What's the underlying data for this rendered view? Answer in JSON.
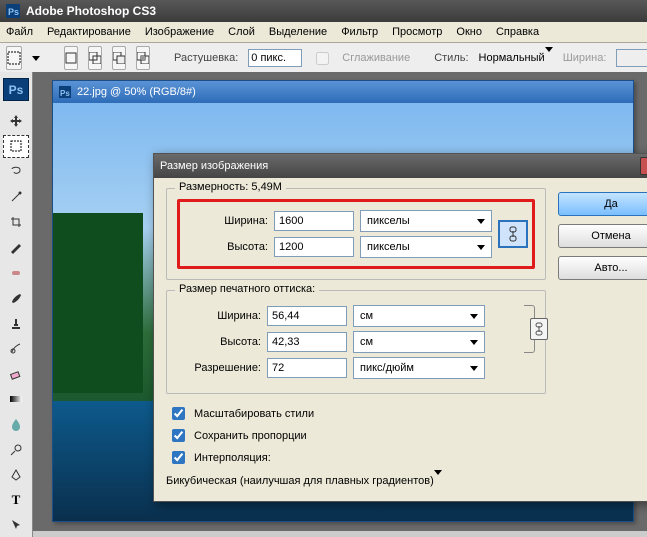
{
  "app": {
    "name": "Adobe Photoshop CS3"
  },
  "menu": {
    "file": "Файл",
    "edit": "Редактирование",
    "image": "Изображение",
    "layer": "Слой",
    "select": "Выделение",
    "filter": "Фильтр",
    "view": "Просмотр",
    "window": "Окно",
    "help": "Справка"
  },
  "options": {
    "feather_label": "Растушевка:",
    "feather_value": "0 пикс.",
    "antialias_label": "Сглаживание",
    "style_label": "Стиль:",
    "style_value": "Нормальный",
    "width_label": "Ширина:",
    "width_value": ""
  },
  "doc": {
    "title": "22.jpg @ 50% (RGB/8#)"
  },
  "dialog": {
    "title": "Размер изображения",
    "pixel_dimensions_label": "Размерность:",
    "pixel_dimensions_value": "5,49M",
    "px_width_label": "Ширина:",
    "px_width_value": "1600",
    "px_height_label": "Высота:",
    "px_height_value": "1200",
    "px_unit": "пикселы",
    "doc_size_label": "Размер печатного оттиска:",
    "doc_width_label": "Ширина:",
    "doc_width_value": "56,44",
    "doc_height_label": "Высота:",
    "doc_height_value": "42,33",
    "doc_unit": "см",
    "resolution_label": "Разрешение:",
    "resolution_value": "72",
    "resolution_unit": "пикс/дюйм",
    "scale_styles": "Масштабировать стили",
    "constrain": "Сохранить пропорции",
    "resample": "Интерполяция:",
    "resample_method": "Бикубическая (наилучшая для плавных градиентов)",
    "ok": "Да",
    "cancel": "Отмена",
    "auto": "Авто..."
  }
}
